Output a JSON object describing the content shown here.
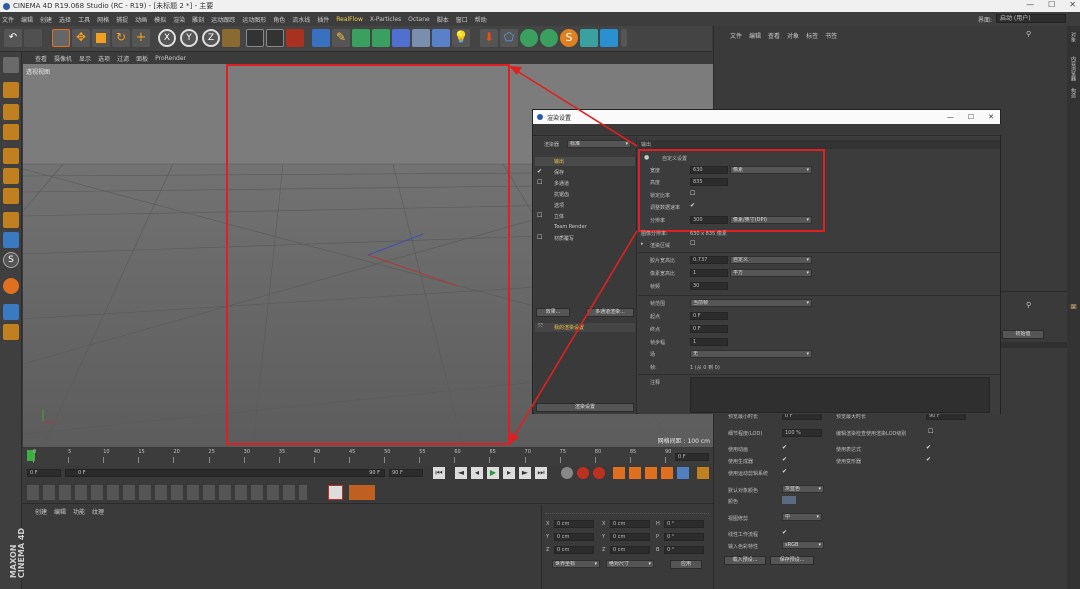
{
  "window": {
    "title": "CINEMA 4D R19.068 Studio (RC - R19) - [未标题 2 *] - 主要",
    "controls": [
      "—",
      "☐",
      "✕"
    ]
  },
  "menu": {
    "items": [
      "文件",
      "编辑",
      "创建",
      "选择",
      "工具",
      "网格",
      "捕捉",
      "动画",
      "模拟",
      "渲染",
      "雕刻",
      "运动跟踪",
      "运动图形",
      "角色",
      "流水线",
      "插件",
      "RealFlow",
      "X-Particles",
      "Octane",
      "脚本",
      "窗口",
      "帮助"
    ],
    "layout_label": "界面:",
    "layout_value": "启动 (用户)"
  },
  "viewport": {
    "menu": [
      "查看",
      "摄像机",
      "显示",
      "选项",
      "过滤",
      "面板",
      "ProRender"
    ],
    "label": "透视视图",
    "grid_info": "网格间距 : 100 cm"
  },
  "timeline": {
    "ticks": [
      "0",
      "5",
      "10",
      "15",
      "20",
      "25",
      "30",
      "35",
      "40",
      "45",
      "50",
      "55",
      "60",
      "65",
      "70",
      "75",
      "80",
      "85",
      "90"
    ],
    "end_field": "0 F",
    "start_field": "0 F",
    "slider_value": "0 F",
    "slider_end": "90 F",
    "max_field": "90 F"
  },
  "material_panel": {
    "menu": [
      "创建",
      "编辑",
      "功能",
      "纹理"
    ],
    "brand_line1": "MAXON",
    "brand_line2": "CINEMA 4D"
  },
  "coord_panel": {
    "rows": [
      {
        "a": "X",
        "av": "0 cm",
        "b": "X",
        "bv": "0 cm",
        "c": "H",
        "cv": "0 °"
      },
      {
        "a": "Y",
        "av": "0 cm",
        "b": "Y",
        "bv": "0 cm",
        "c": "P",
        "cv": "0 °"
      },
      {
        "a": "Z",
        "av": "0 cm",
        "b": "Z",
        "bv": "0 cm",
        "c": "B",
        "cv": "0 °"
      }
    ],
    "world": "世界坐标",
    "scale": "绝对尺寸",
    "apply": "应用"
  },
  "right_panel": {
    "menu": [
      "文件",
      "编辑",
      "查看",
      "对象",
      "标签",
      "书签"
    ],
    "proj_btn": "初始值",
    "rows": [
      {
        "label": "预览最小时长",
        "value": "0 F",
        "label2": "预览最大时长",
        "value2": "90 F"
      },
      {
        "label": "细节程度(LOD)",
        "value": "100 %",
        "label2": "编辑渲染检查使用渲染LOD级别"
      },
      {
        "label": "使用动画",
        "label2": "使用表达式"
      },
      {
        "label": "使用生成器",
        "label2": "使用变形器"
      },
      {
        "label": "使用运动剪辑系统"
      }
    ],
    "default_color_label": "默认对象颜色",
    "default_color_value": "灰蓝色",
    "color_label": "颜色",
    "view_clip_label": "视图修剪",
    "view_clip_value": "中",
    "linear_label": "线性工作流程",
    "input_color_label": "输入色彩特性",
    "input_color_value": "sRGB",
    "load_btn": "载入预设...",
    "save_btn": "保存预设..."
  },
  "right_strip": [
    "对象",
    "内容浏览器",
    "构造",
    "层"
  ],
  "render_dialog": {
    "title": "渲染设置",
    "renderer_label": "渲染器",
    "renderer_value": "标准",
    "nav": [
      "输出",
      "保存",
      "多通道",
      "抗锯齿",
      "选项",
      "立体",
      "Team Render",
      "材质覆写"
    ],
    "effect_btn": "效果...",
    "multi_btn": "多通道渲染...",
    "my_setting": "我的渲染设置",
    "render_setting_btn": "渲染设置",
    "section": "输出",
    "preset": "自定义设置",
    "width_label": "宽度",
    "width_value": "630",
    "unit_value": "像素",
    "height_label": "高度",
    "height_value": "835",
    "lock_ratio": "锁定比率",
    "adapt_data": "调整数据速率",
    "resolution_label": "分辨率",
    "resolution_value": "300",
    "resolution_unit": "像素/英寸(DPI)",
    "image_res_label": "图像分辨率:",
    "image_res_value": "630 x 835 像素",
    "render_region": "渲染区域",
    "film_ratio_label": "胶片宽高比",
    "film_ratio_value": "0.737",
    "film_ratio_drop": "自定义",
    "pixel_ratio_label": "像素宽高比",
    "pixel_ratio_value": "1",
    "pixel_ratio_drop": "平方",
    "fps_label": "帧频",
    "fps_value": "30",
    "frame_range_label": "帧范围",
    "frame_range_value": "当前帧",
    "start_label": "起点",
    "start_value": "0 F",
    "end_label": "终点",
    "end_value": "0 F",
    "step_label": "帧步幅",
    "step_value": "1",
    "field_label": "场",
    "field_value": "无",
    "frames_label": "帧:",
    "frames_value": "1 (从 0 到 0)",
    "notes_label": "注释"
  }
}
